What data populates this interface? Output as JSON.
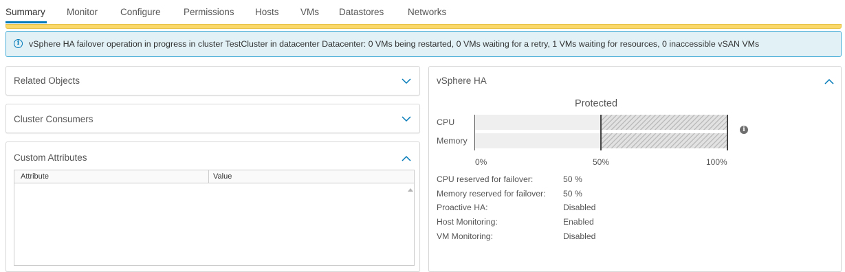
{
  "tabs": [
    {
      "label": "Summary",
      "active": true
    },
    {
      "label": "Monitor"
    },
    {
      "label": "Configure"
    },
    {
      "label": "Permissions"
    },
    {
      "label": "Hosts"
    },
    {
      "label": "VMs"
    },
    {
      "label": "Datastores"
    },
    {
      "label": "Networks"
    }
  ],
  "alert": {
    "icon": "info-icon",
    "text": "vSphere HA failover operation in progress in cluster TestCluster in datacenter Datacenter: 0 VMs being restarted, 0 VMs waiting for a retry, 1 VMs waiting for resources, 0 inaccessible vSAN VMs"
  },
  "left_panels": {
    "related_objects": {
      "title": "Related Objects",
      "expanded": false
    },
    "cluster_consumers": {
      "title": "Cluster Consumers",
      "expanded": false
    },
    "custom_attributes": {
      "title": "Custom Attributes",
      "expanded": true,
      "columns": [
        "Attribute",
        "Value"
      ],
      "rows": []
    }
  },
  "vsphere_ha": {
    "title": "vSphere HA",
    "expanded": true,
    "status": "Protected",
    "bars": [
      {
        "label": "CPU",
        "reserved_fraction": 0.5
      },
      {
        "label": "Memory",
        "reserved_fraction": 0.5
      }
    ],
    "ticks": [
      "0%",
      "50%",
      "100%"
    ],
    "details": [
      {
        "label": "CPU reserved for failover:",
        "value": "50 %"
      },
      {
        "label": "Memory reserved for failover:",
        "value": "50 %"
      },
      {
        "label": "Proactive HA:",
        "value": "Disabled"
      },
      {
        "label": "Host Monitoring:",
        "value": "Enabled"
      },
      {
        "label": "VM Monitoring:",
        "value": "Disabled"
      }
    ]
  },
  "colors": {
    "accent": "#0079b8",
    "warning_strip": "#fbd86a",
    "alert_bg": "#e1f1f6",
    "alert_border": "#49afd9"
  }
}
